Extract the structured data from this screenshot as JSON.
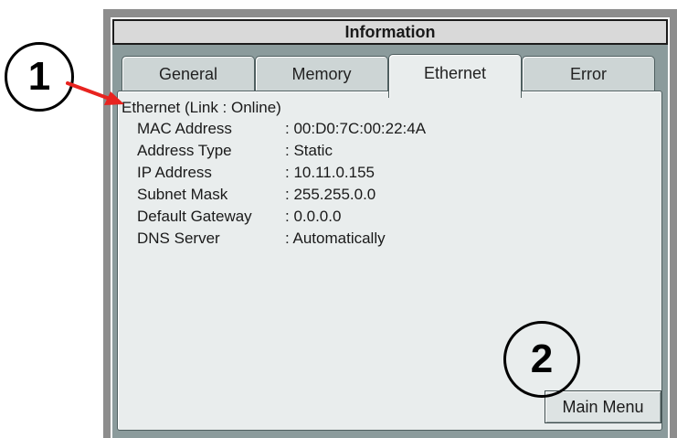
{
  "window": {
    "title": "Information"
  },
  "tabs": [
    {
      "label": "General",
      "active": false
    },
    {
      "label": "Memory",
      "active": false
    },
    {
      "label": "Ethernet",
      "active": true
    },
    {
      "label": "Error",
      "active": false
    }
  ],
  "ethernet": {
    "heading": "Ethernet (Link : Online)",
    "rows": [
      {
        "label": "MAC Address",
        "value": ": 00:D0:7C:00:22:4A"
      },
      {
        "label": "Address Type",
        "value": ": Static"
      },
      {
        "label": "IP Address",
        "value": ": 10.11.0.155"
      },
      {
        "label": "Subnet Mask",
        "value": ": 255.255.0.0"
      },
      {
        "label": "Default Gateway",
        "value": ": 0.0.0.0"
      },
      {
        "label": "DNS Server",
        "value": ": Automatically"
      }
    ]
  },
  "buttons": {
    "main_menu": "Main Menu"
  },
  "callouts": {
    "one": "1",
    "two": "2"
  },
  "colors": {
    "arrow": "#e8231f",
    "frame": "#8d8d8d",
    "tab_area": "#8b9b9c",
    "panel": "#e9eded"
  },
  "icons": {
    "callout_arrow": "red-arrow-icon"
  }
}
